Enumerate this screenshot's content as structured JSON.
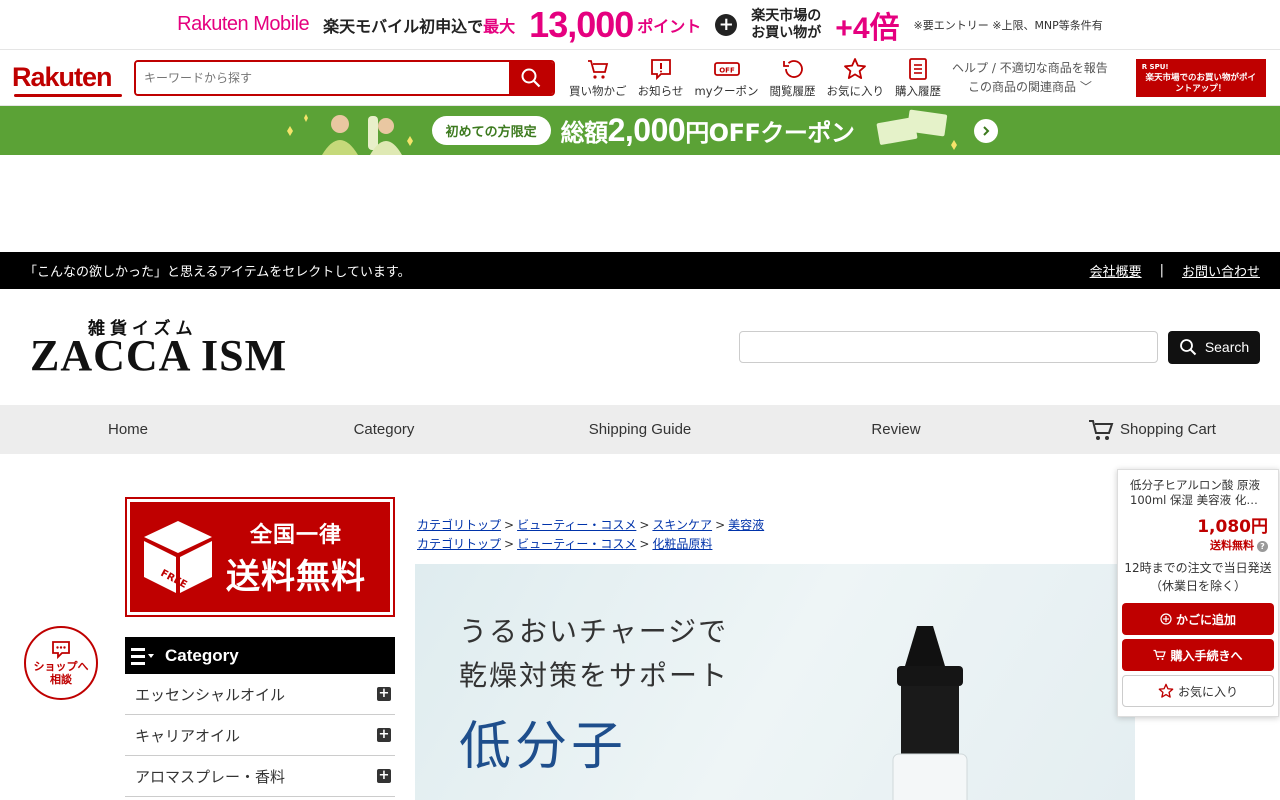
{
  "promo": {
    "brand": "Rakuten Mobile",
    "text1": "楽天モバイル初申込で",
    "text1_em": "最大",
    "big_number": "13,000",
    "points": "ポイント",
    "plus": "+",
    "text2_line1": "楽天市場の",
    "text2_line2": "お買い物が",
    "multiplier": "+4倍",
    "note": "※要エントリー ※上限、MNP等条件有"
  },
  "header": {
    "logo": "Rakuten",
    "search_placeholder": "キーワードから探す",
    "icons": [
      {
        "label": "買い物かご",
        "icon": "cart-icon"
      },
      {
        "label": "お知らせ",
        "icon": "notification-icon"
      },
      {
        "label": "myクーポン",
        "icon": "coupon-icon"
      },
      {
        "label": "閲覧履歴",
        "icon": "history-icon"
      },
      {
        "label": "お気に入り",
        "icon": "star-icon"
      },
      {
        "label": "購入履歴",
        "icon": "receipt-icon"
      }
    ],
    "help_link": "ヘルプ / 不適切な商品を報告",
    "related_link": "この商品の関連商品",
    "spu_badge": "R SPU!",
    "spu_text": "楽天市場でのお買い物がポイントアップ！"
  },
  "coupon_banner": {
    "pill": "初めての方限定",
    "prefix": "総額",
    "amount": "2,000",
    "suffix": "円OFFクーポン"
  },
  "tagline": {
    "text": "「こんなの欲しかった」と思えるアイテムをセレクトしています。",
    "links": [
      "会社概要",
      "お問い合わせ"
    ],
    "separator": "|"
  },
  "shop": {
    "logo_kana": "雑貨イズム",
    "logo_main": "ZACCA ISM",
    "search_button": "Search"
  },
  "nav": {
    "items": [
      "Home",
      "Category",
      "Shipping Guide",
      "Review",
      "Shopping Cart"
    ]
  },
  "chat_button": {
    "line1": "ショップへ",
    "line2": "相談"
  },
  "sidebar": {
    "free_line1": "全国一律",
    "free_line2": "送料無料",
    "free_box_text": "FREE",
    "category_title": "Category",
    "categories": [
      "エッセンシャルオイル",
      "キャリアオイル",
      "アロマスプレー・香料"
    ]
  },
  "breadcrumbs": [
    [
      "カテゴリトップ",
      "ビューティー・コスメ",
      "スキンケア",
      "美容液"
    ],
    [
      "カテゴリトップ",
      "ビューティー・コスメ",
      "化粧品原料"
    ]
  ],
  "hero": {
    "line1": "うるおいチャージで",
    "line2": "乾燥対策をサポート",
    "headline": "低分子"
  },
  "widget": {
    "product_name": "低分子ヒアルロン酸 原液 100ml 保湿 美容液 化…",
    "price": "1,080円",
    "shipping": "送料無料",
    "delivery": "12時までの注文で当日発送（休業日を除く）",
    "add_cart": "かごに追加",
    "checkout": "購入手続きへ",
    "favorite": "お気に入り"
  },
  "colors": {
    "rakuten_red": "#bf0000",
    "mobile_pink": "#e5007f",
    "coupon_green": "#5ba236"
  }
}
